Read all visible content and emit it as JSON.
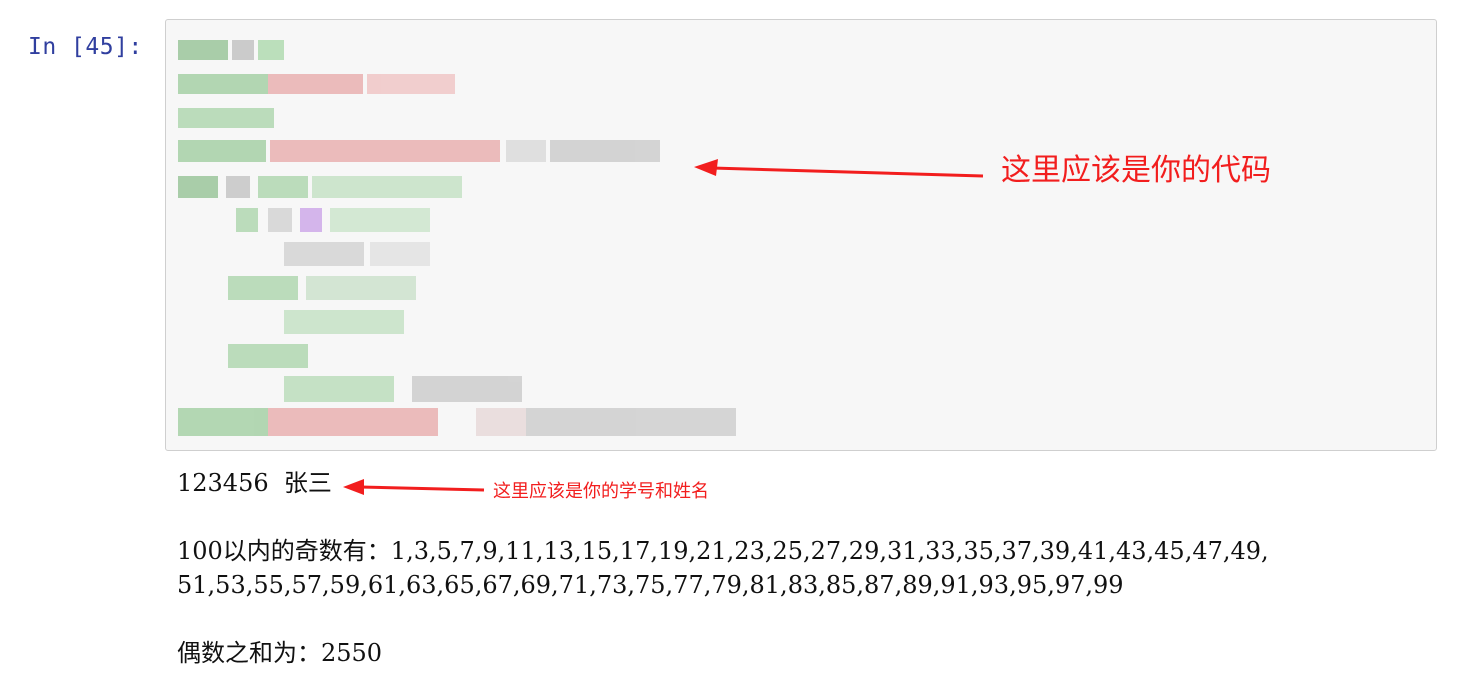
{
  "cell": {
    "prompt": "In  [45]:"
  },
  "annotations": {
    "code_note": "这里应该是你的代码",
    "id_note": "这里应该是你的学号和姓名",
    "color": "#f21e1e"
  },
  "output": {
    "id_line": "123456  张三",
    "odd_line_1": "100以内的奇数有：1,3,5,7,9,11,13,15,17,19,21,23,25,27,29,31,33,35,37,39,41,43,45,47,49,",
    "odd_line_2": "51,53,55,57,59,61,63,65,67,69,71,73,75,77,79,81,83,85,87,89,91,93,95,97,99",
    "sum_line": "偶数之和为：2550"
  }
}
